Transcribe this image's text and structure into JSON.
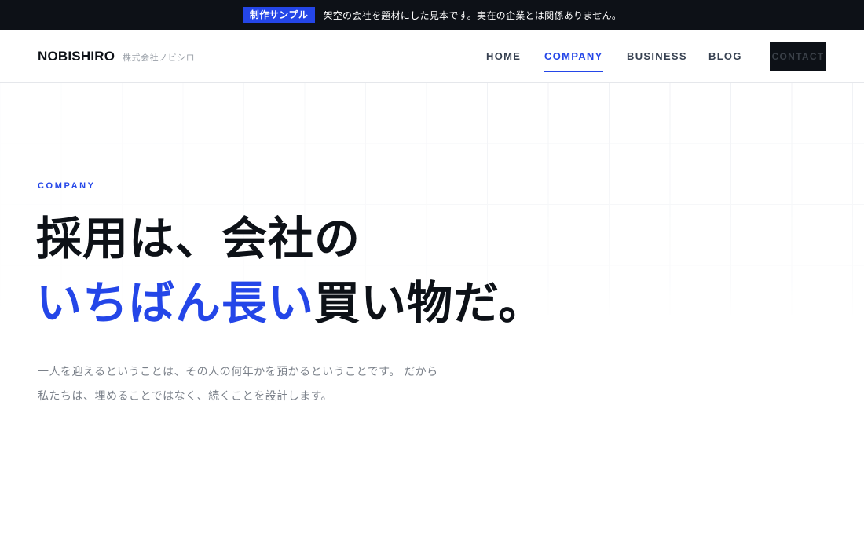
{
  "notice": {
    "badge": "制作サンプル",
    "text": "架空の会社を題材にした見本です。実在の企業とは関係ありません。"
  },
  "header": {
    "logo": "NOBISHIRO",
    "logo_sub": "株式会社ノビシロ",
    "nav": {
      "home": "HOME",
      "company": "COMPANY",
      "business": "BUSINESS",
      "blog": "BLOG"
    },
    "active_nav": "COMPANY",
    "contact": "CONTACT"
  },
  "hero": {
    "eyebrow": "COMPANY",
    "headline_line1": "採用は、会社の",
    "headline_accent": "いちばん長い",
    "headline_rest": "買い物だ。",
    "lead": "一人を迎えるということは、その人の何年かを預かるということです。 だから私たちは、埋めることではなく、続くことを設計します。"
  },
  "colors": {
    "accent": "#2446e8",
    "dark": "#0d1117",
    "muted_text": "#7b818a"
  }
}
